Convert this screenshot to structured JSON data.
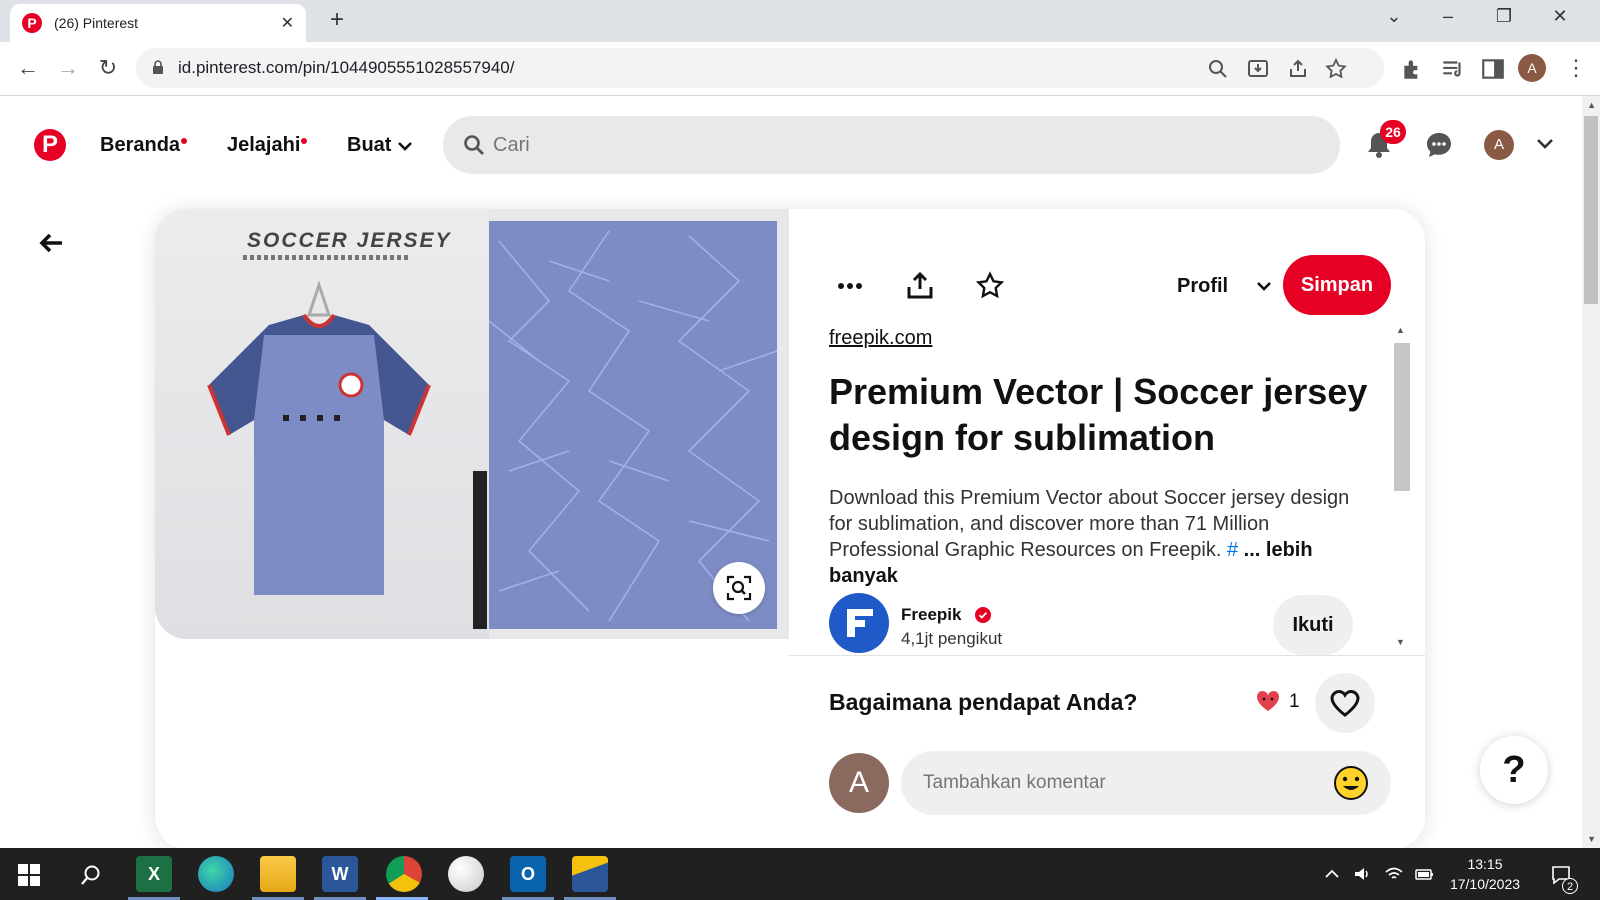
{
  "browser": {
    "tab_title": "(26) Pinterest",
    "url": "id.pinterest.com/pin/1044905551028557940/"
  },
  "header": {
    "nav": [
      "Beranda",
      "Jelajahi",
      "Buat"
    ],
    "search_placeholder": "Cari",
    "notification_count": "26",
    "avatar_initial": "A"
  },
  "pin": {
    "image_text": "SOCCER JERSEY",
    "source": "freepik.com",
    "title": "Premium Vector | Soccer jersey design for sublimation",
    "description": "Download this Premium Vector about Soccer jersey design for sublimation, and discover more than 71 Million Professional Graphic Resources on Freepik.",
    "hashtag": "#",
    "more_label": "... lebih banyak",
    "profile_label": "Profil",
    "save_label": "Simpan"
  },
  "creator": {
    "name": "Freepik",
    "followers": "4,1jt pengikut",
    "follow_label": "Ikuti"
  },
  "comments": {
    "prompt": "Bagaimana pendapat Anda?",
    "reaction_count": "1",
    "placeholder": "Tambahkan komentar",
    "avatar_initial": "A"
  },
  "help_label": "?",
  "taskbar": {
    "time": "13:15",
    "date": "17/10/2023",
    "notification_count": "2"
  },
  "colors": {
    "brand": "#e60023",
    "jersey_blue": "#7e8cc6",
    "chrome_bg": "#dee1e6",
    "taskbar_bg": "#202020"
  }
}
